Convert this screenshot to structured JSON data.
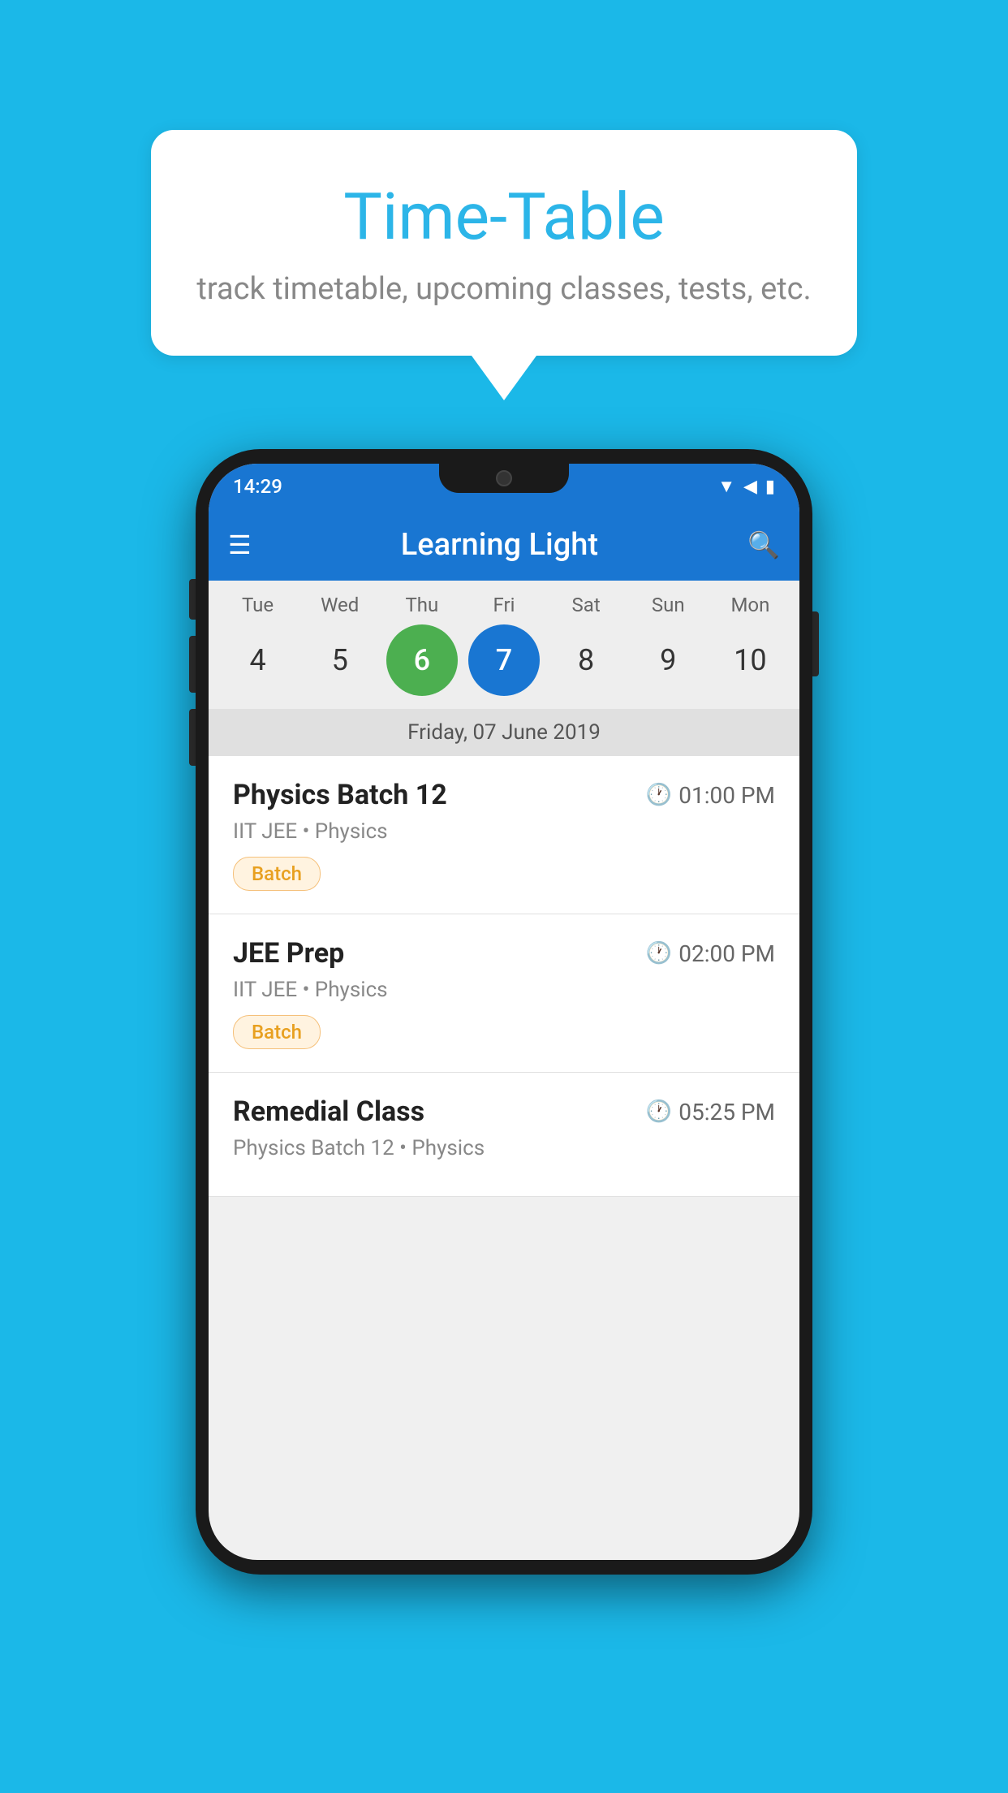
{
  "background_color": "#1BB8E8",
  "speech_bubble": {
    "title": "Time-Table",
    "subtitle": "track timetable, upcoming classes, tests, etc."
  },
  "phone": {
    "status_bar": {
      "time": "14:29",
      "icons": [
        "wifi",
        "signal",
        "battery"
      ]
    },
    "app_bar": {
      "title": "Learning Light",
      "menu_icon": "☰",
      "search_icon": "🔍"
    },
    "calendar": {
      "days": [
        "Tue",
        "Wed",
        "Thu",
        "Fri",
        "Sat",
        "Sun",
        "Mon"
      ],
      "dates": [
        "4",
        "5",
        "6",
        "7",
        "8",
        "9",
        "10"
      ],
      "today_index": 2,
      "selected_index": 3,
      "selected_date_label": "Friday, 07 June 2019"
    },
    "schedule_items": [
      {
        "title": "Physics Batch 12",
        "time": "01:00 PM",
        "sub": "IIT JEE • Physics",
        "badge": "Batch"
      },
      {
        "title": "JEE Prep",
        "time": "02:00 PM",
        "sub": "IIT JEE • Physics",
        "badge": "Batch"
      },
      {
        "title": "Remedial Class",
        "time": "05:25 PM",
        "sub": "Physics Batch 12 • Physics",
        "badge": null
      }
    ]
  }
}
